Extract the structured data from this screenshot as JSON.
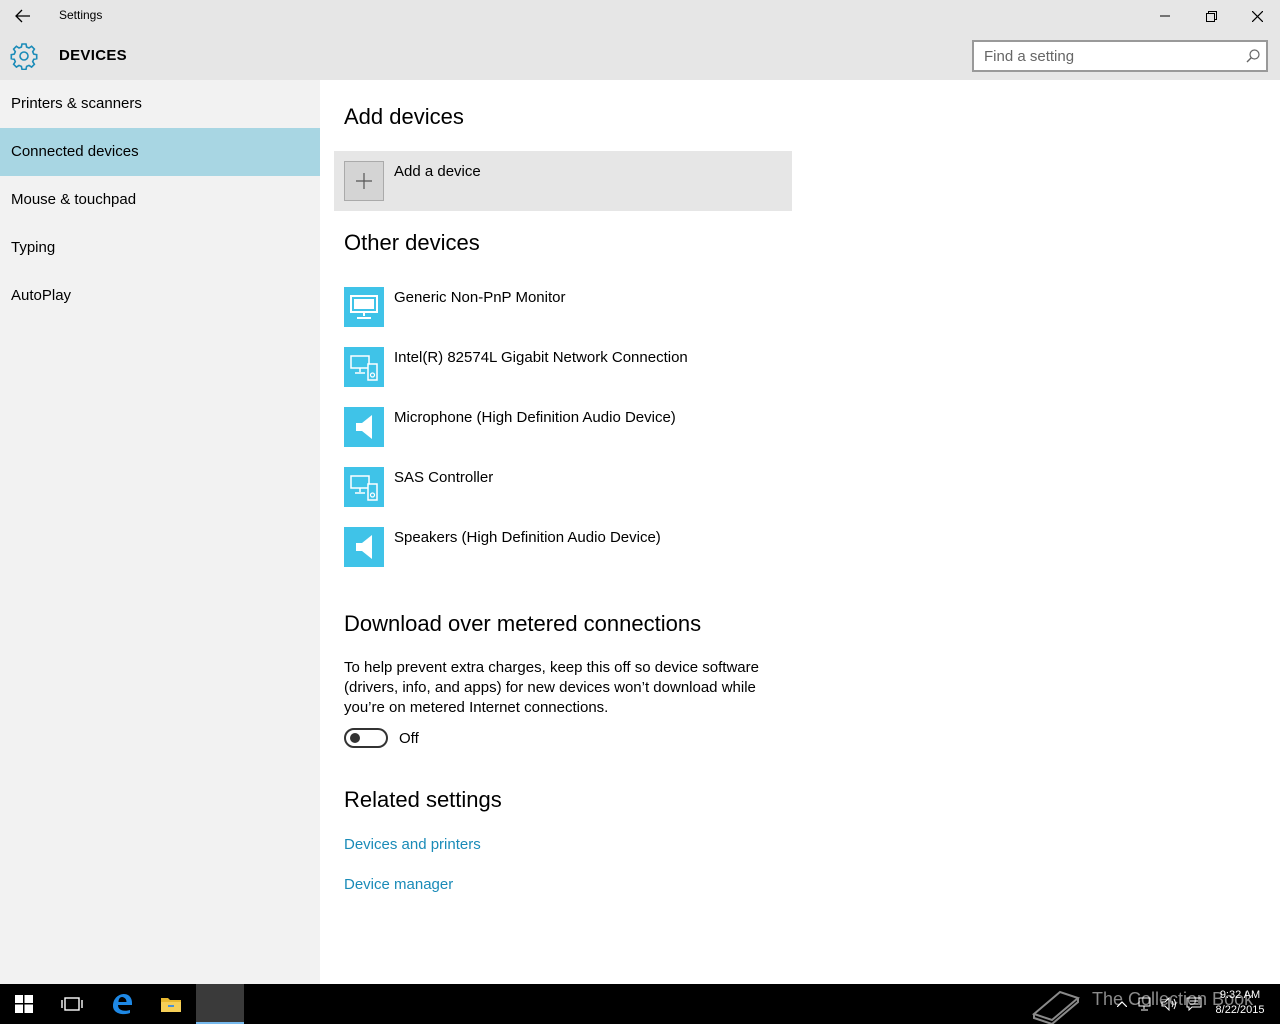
{
  "window": {
    "title": "Settings",
    "back_icon": "back-arrow-icon",
    "minimize_icon": "minimize-icon",
    "restore_icon": "restore-icon",
    "close_icon": "close-icon"
  },
  "header": {
    "icon": "gear-icon",
    "section_title": "DEVICES",
    "search_placeholder": "Find a setting",
    "search_icon": "search-icon"
  },
  "sidebar": {
    "items": [
      {
        "label": "Printers & scanners",
        "active": false
      },
      {
        "label": "Connected devices",
        "active": true
      },
      {
        "label": "Mouse & touchpad",
        "active": false
      },
      {
        "label": "Typing",
        "active": false
      },
      {
        "label": "AutoPlay",
        "active": false
      }
    ]
  },
  "main": {
    "add_devices_heading": "Add devices",
    "add_device_label": "Add a device",
    "other_devices_heading": "Other devices",
    "devices": [
      {
        "name": "Generic Non-PnP Monitor",
        "icon": "monitor-icon"
      },
      {
        "name": "Intel(R) 82574L Gigabit Network Connection",
        "icon": "devices-icon"
      },
      {
        "name": "Microphone (High Definition Audio Device)",
        "icon": "speaker-icon"
      },
      {
        "name": "SAS Controller",
        "icon": "devices-icon"
      },
      {
        "name": "Speakers (High Definition Audio Device)",
        "icon": "speaker-icon"
      }
    ],
    "metered_heading": "Download over metered connections",
    "metered_description": "To help prevent extra charges, keep this off so device software (drivers, info, and apps) for new devices won’t download while you’re on metered Internet connections.",
    "metered_toggle_state": "Off",
    "related_heading": "Related settings",
    "related_links": [
      "Devices and printers",
      "Device manager"
    ]
  },
  "taskbar": {
    "watermark": "The Collection Book",
    "time": "9:32 AM",
    "date": "8/22/2015"
  },
  "colors": {
    "accent": "#3fc3e8",
    "nav_active": "#a8d6e3",
    "link": "#1a8bb8",
    "gear": "#1a8bb8"
  }
}
